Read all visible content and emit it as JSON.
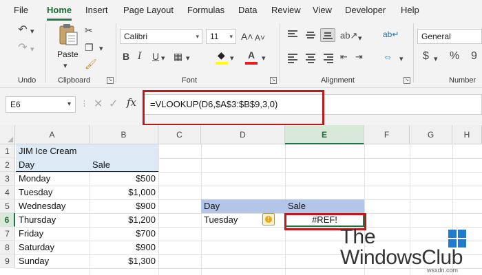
{
  "menu": {
    "tabs": [
      "File",
      "Home",
      "Insert",
      "Page Layout",
      "Formulas",
      "Data",
      "Review",
      "View",
      "Developer",
      "Help"
    ],
    "active": "Home"
  },
  "ribbon": {
    "undo_label": "Undo",
    "clipboard_label": "Clipboard",
    "paste_label": "Paste",
    "font_label": "Font",
    "alignment_label": "Alignment",
    "number_label": "Number",
    "font_name": "Calibri",
    "font_size": "11",
    "number_format": "General",
    "bold": "B",
    "italic": "I",
    "underline": "U",
    "currency": "$",
    "percent": "%",
    "comma": "9",
    "increase_font": "A",
    "decrease_font": "A"
  },
  "formula_bar": {
    "name_box": "E6",
    "fx": "fx",
    "formula": "=VLOOKUP(D6,$A$3:$B$9,3,0)"
  },
  "grid": {
    "columns": [
      "A",
      "B",
      "C",
      "D",
      "E",
      "F",
      "G",
      "H"
    ],
    "selected_column": "E",
    "rows": [
      "1",
      "2",
      "3",
      "4",
      "5",
      "6",
      "7",
      "8",
      "9"
    ],
    "selected_row": "6",
    "title": "JIM Ice Cream",
    "headers": {
      "day": "Day",
      "sale": "Sale"
    },
    "data": [
      {
        "day": "Monday",
        "sale": "$500"
      },
      {
        "day": "Tuesday",
        "sale": "$1,000"
      },
      {
        "day": "Wednesday",
        "sale": "$900"
      },
      {
        "day": "Thursday",
        "sale": "$1,200"
      },
      {
        "day": "Friday",
        "sale": "$700"
      },
      {
        "day": "Saturday",
        "sale": "$900"
      },
      {
        "day": "Sunday",
        "sale": "$1,300"
      }
    ],
    "lookup": {
      "header_day": "Day",
      "header_sale": "Sale",
      "day": "Tuesday",
      "result": "#REF!"
    },
    "warning_glyph": "!"
  },
  "colors": {
    "accent": "#217346",
    "highlight": "#c0171b",
    "table_fill": "#dde9f5",
    "lookup_header_fill": "#b4c6e7"
  },
  "watermark": {
    "line1": "The",
    "line2": "WindowsClub",
    "site": "wsxdn.com"
  }
}
